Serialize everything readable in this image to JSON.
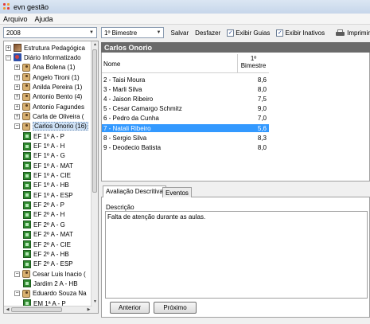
{
  "window": {
    "title": "evn gestão"
  },
  "menu": [
    "Arquivo",
    "Ajuda"
  ],
  "year_select": {
    "value": "2008"
  },
  "toolbar": {
    "period_select": "1º Bimestre",
    "save_label": "Salvar",
    "undo_label": "Desfazer",
    "show_tabs_label": "Exibir Guias",
    "show_tabs_checked": true,
    "show_inactive_label": "Exibir Inativos",
    "show_inactive_checked": true,
    "print_label": "Imprimir"
  },
  "tree": {
    "items": [
      {
        "label": "Estrutura Pedagógica",
        "expander": "+",
        "icon": "book-icon"
      },
      {
        "label": "Diário Informatizado",
        "expander": "−",
        "icon": "diary-icon"
      },
      {
        "label": "Ana Bolena (1)",
        "expander": "+",
        "icon": "user-icon"
      },
      {
        "label": "Angelo Tironi (1)",
        "expander": "+",
        "icon": "user-icon"
      },
      {
        "label": "Anilda Pereira (1)",
        "expander": "+",
        "icon": "user-icon"
      },
      {
        "label": "Antonio Bento (4)",
        "expander": "+",
        "icon": "user-icon"
      },
      {
        "label": "Antonio Fagundes",
        "expander": "+",
        "icon": "user-icon"
      },
      {
        "label": "Carla de Oliveira (",
        "expander": "+",
        "icon": "user-icon"
      },
      {
        "label": "Carlos Onorio (16)",
        "expander": "−",
        "icon": "user-icon",
        "selected": true
      },
      {
        "label": "EF 1º A - P",
        "icon": "class-icon"
      },
      {
        "label": "EF 1º A - H",
        "icon": "class-icon"
      },
      {
        "label": "EF 1º A - G",
        "icon": "class-icon"
      },
      {
        "label": "EF 1º A - MAT",
        "icon": "class-icon"
      },
      {
        "label": "EF 1º A - CIE",
        "icon": "class-icon"
      },
      {
        "label": "EF 1º A - HB",
        "icon": "class-icon"
      },
      {
        "label": "EF 1º A - ESP",
        "icon": "class-icon"
      },
      {
        "label": "EF 2º A - P",
        "icon": "class-icon"
      },
      {
        "label": "EF 2º A - H",
        "icon": "class-icon"
      },
      {
        "label": "EF 2º A - G",
        "icon": "class-icon"
      },
      {
        "label": "EF 2º A - MAT",
        "icon": "class-icon"
      },
      {
        "label": "EF 2º A - CIE",
        "icon": "class-icon"
      },
      {
        "label": "EF 2º A - HB",
        "icon": "class-icon"
      },
      {
        "label": "EF 2º A - ESP",
        "icon": "class-icon"
      },
      {
        "label": "Cesar Luis Inacio (",
        "expander": "−",
        "icon": "user-icon"
      },
      {
        "label": "Jardim 2 A - HB",
        "icon": "class-icon"
      },
      {
        "label": "Eduardo Souza Na",
        "expander": "−",
        "icon": "user-icon"
      },
      {
        "label": "EM 1ª A - P",
        "icon": "class-icon"
      }
    ]
  },
  "student": {
    "name": "Carlos Onorio"
  },
  "grades": {
    "col_name": "Nome",
    "col_period": "1º Bimestre",
    "rows": [
      {
        "name": "2 - Taisi Moura",
        "grade": "8,6"
      },
      {
        "name": "3 - Marli Silva",
        "grade": "8,0"
      },
      {
        "name": "4 - Jaison Ribeiro",
        "grade": "7,5"
      },
      {
        "name": "5 - Cesar Camargo Schmitz",
        "grade": "9,0"
      },
      {
        "name": "6 - Pedro da Cunha",
        "grade": "7,0"
      },
      {
        "name": "7 - Natali Ribeiro",
        "grade": "5,6",
        "selected": true
      },
      {
        "name": "8 - Sergio Silva",
        "grade": "8,3"
      },
      {
        "name": "9 - Deodecio Batista",
        "grade": "8,0"
      }
    ]
  },
  "tabs": [
    "Avaliação Descritiva",
    "Eventos"
  ],
  "description": {
    "label": "Descrição",
    "text": "Falta de atenção durante as aulas."
  },
  "buttons": {
    "prev": "Anterior",
    "next": "Próximo"
  }
}
